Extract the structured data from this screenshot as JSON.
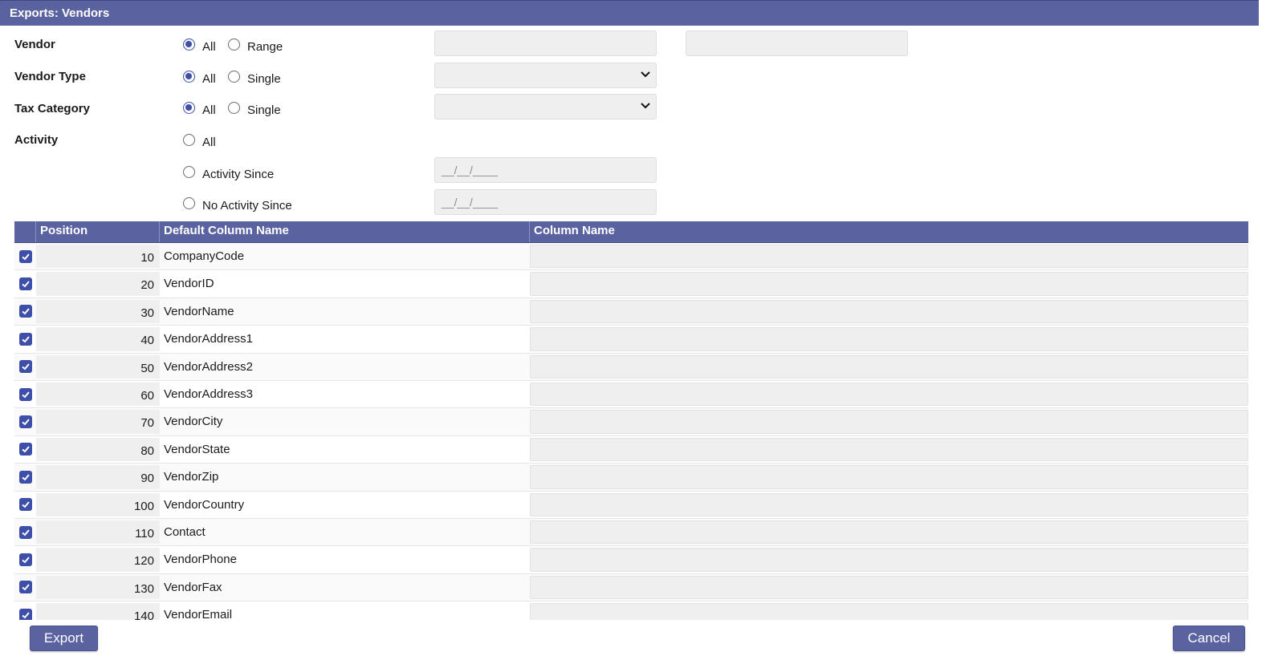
{
  "window": {
    "title": "Exports: Vendors"
  },
  "filters": {
    "vendor": {
      "label": "Vendor",
      "opt_all": "All",
      "opt_other": "Range"
    },
    "vendor_type": {
      "label": "Vendor Type",
      "opt_all": "All",
      "opt_other": "Single"
    },
    "tax_category": {
      "label": "Tax Category",
      "opt_all": "All",
      "opt_other": "Single"
    },
    "activity": {
      "label": "Activity",
      "opt_all": "All",
      "opt_since": "Activity Since",
      "opt_no_since": "No Activity Since",
      "since_placeholder": "__/__/____",
      "no_since_placeholder": "__/__/____"
    }
  },
  "grid": {
    "headers": {
      "position": "Position",
      "default_name": "Default Column Name",
      "column_name": "Column Name"
    },
    "rows": [
      {
        "position": "10",
        "name": "CompanyCode",
        "checked": true
      },
      {
        "position": "20",
        "name": "VendorID",
        "checked": true
      },
      {
        "position": "30",
        "name": "VendorName",
        "checked": true
      },
      {
        "position": "40",
        "name": "VendorAddress1",
        "checked": true
      },
      {
        "position": "50",
        "name": "VendorAddress2",
        "checked": true
      },
      {
        "position": "60",
        "name": "VendorAddress3",
        "checked": true
      },
      {
        "position": "70",
        "name": "VendorCity",
        "checked": true
      },
      {
        "position": "80",
        "name": "VendorState",
        "checked": true
      },
      {
        "position": "90",
        "name": "VendorZip",
        "checked": true
      },
      {
        "position": "100",
        "name": "VendorCountry",
        "checked": true
      },
      {
        "position": "110",
        "name": "Contact",
        "checked": true
      },
      {
        "position": "120",
        "name": "VendorPhone",
        "checked": true
      },
      {
        "position": "130",
        "name": "VendorFax",
        "checked": true
      },
      {
        "position": "140",
        "name": "VendorEmail",
        "checked": true
      }
    ]
  },
  "actions": {
    "export": "Export",
    "cancel": "Cancel"
  },
  "colors": {
    "accent": "#5a63a0",
    "radio": "#3d4fa8"
  }
}
